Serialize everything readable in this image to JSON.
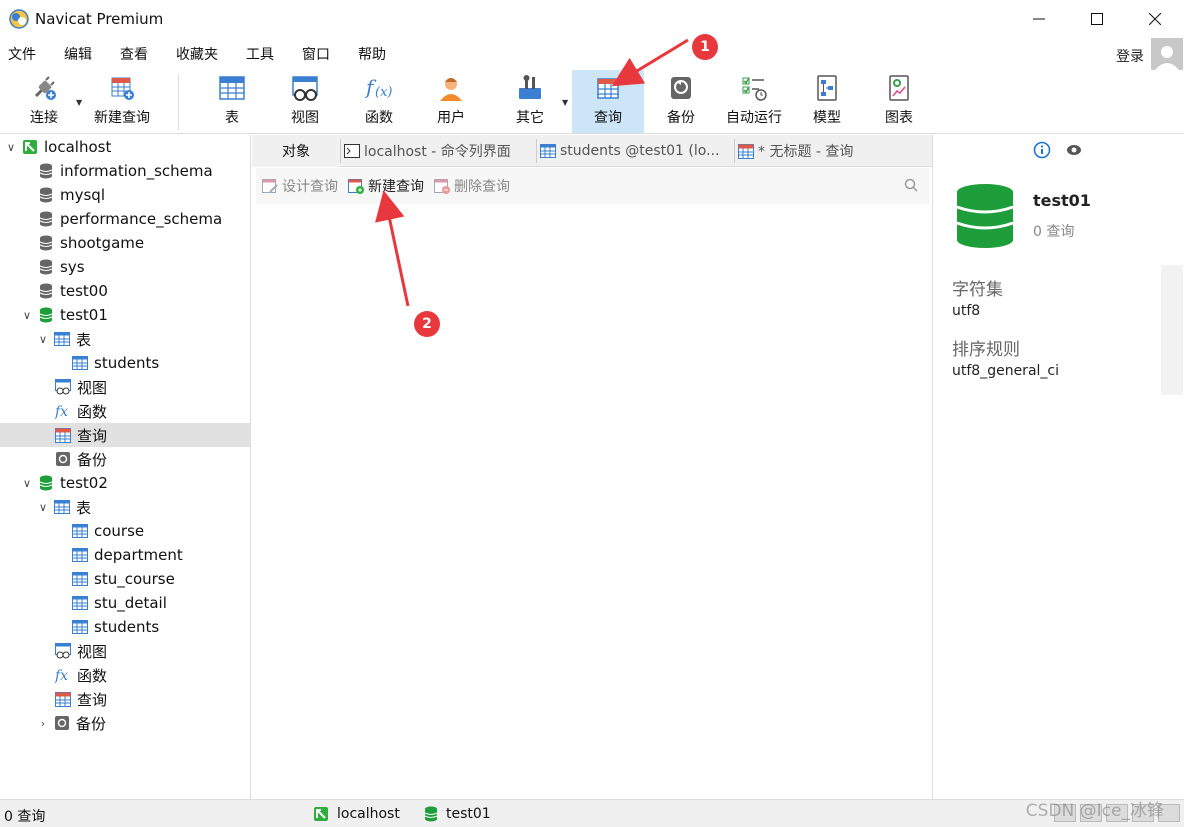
{
  "window": {
    "title": "Navicat Premium"
  },
  "menu": [
    "文件",
    "编辑",
    "查看",
    "收藏夹",
    "工具",
    "窗口",
    "帮助"
  ],
  "login_label": "登录",
  "toolbar": {
    "connect": "连接",
    "new_query": "新建查询",
    "table": "表",
    "view": "视图",
    "function": "函数",
    "user": "用户",
    "other": "其它",
    "query": "查询",
    "backup": "备份",
    "automation": "自动运行",
    "model": "模型",
    "chart": "图表"
  },
  "tree": {
    "connection": "localhost",
    "databases": [
      "information_schema",
      "mysql",
      "performance_schema",
      "shootgame",
      "sys",
      "test00"
    ],
    "test01": {
      "name": "test01",
      "tables_label": "表",
      "tables": [
        "students"
      ],
      "view_label": "视图",
      "function_label": "函数",
      "query_label": "查询",
      "backup_label": "备份"
    },
    "test02": {
      "name": "test02",
      "tables_label": "表",
      "tables": [
        "course",
        "department",
        "stu_course",
        "stu_detail",
        "students"
      ],
      "view_label": "视图",
      "function_label": "函数",
      "query_label": "查询",
      "backup_label": "备份"
    }
  },
  "tabs": {
    "objects": "对象",
    "cmd": "localhost - 命令列界面",
    "students": "students @test01 (lo...",
    "untitled": "* 无标题 - 查询"
  },
  "subtoolbar": {
    "design": "设计查询",
    "new": "新建查询",
    "delete": "删除查询"
  },
  "info": {
    "db_name": "test01",
    "query_count": "0 查询",
    "charset_label": "字符集",
    "charset": "utf8",
    "collation_label": "排序规则",
    "collation": "utf8_general_ci"
  },
  "status": {
    "count": "0 查询",
    "connection": "localhost",
    "database": "test01"
  },
  "annotations": [
    "1",
    "2"
  ],
  "watermark": "CSDN @Ice_冰锋",
  "colors": {
    "db_green": "#1e9e3a",
    "active_tb": "#cde6f7",
    "annotation": "#e8383d",
    "table_blue": "#3a7fd1"
  }
}
